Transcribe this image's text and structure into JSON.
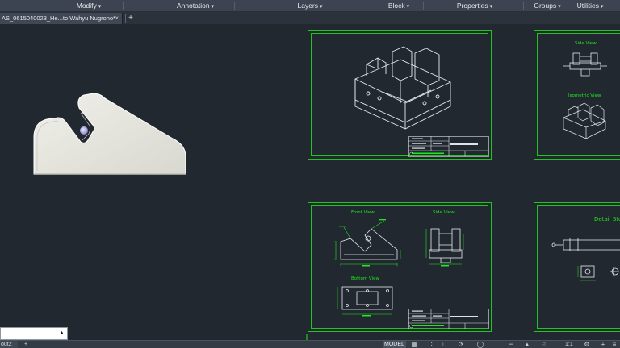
{
  "ribbon": {
    "panels": [
      "Modify",
      "Annotation",
      "Layers",
      "Block",
      "Properties",
      "Groups",
      "Utilities"
    ]
  },
  "file_tab": {
    "label": "AS_0615040023_He...to Wahyu Nugroho*",
    "close": "×",
    "new": "+"
  },
  "sheets": {
    "front_view": "Front View",
    "side_view_top": "Side View",
    "isometric_view": "Isometric View",
    "side_view": "Side View",
    "bottom_view": "Bottom View",
    "detail": "Detail Sto"
  },
  "command_line": {
    "arrow": "▲"
  },
  "status": {
    "layout_tab": "out2",
    "add_layout": "+",
    "model": "MODEL",
    "scale": "1:1",
    "icons": [
      "grid-icon",
      "snap-icon",
      "ortho-icon",
      "polar-icon",
      "osnap-icon",
      "lineweight-icon",
      "annotation-icon",
      "workspace-icon",
      "plus-icon",
      "menu-icon"
    ]
  },
  "colors": {
    "frame_green": "#22c51f",
    "background": "#212830",
    "ribbon": "#3b4450"
  }
}
